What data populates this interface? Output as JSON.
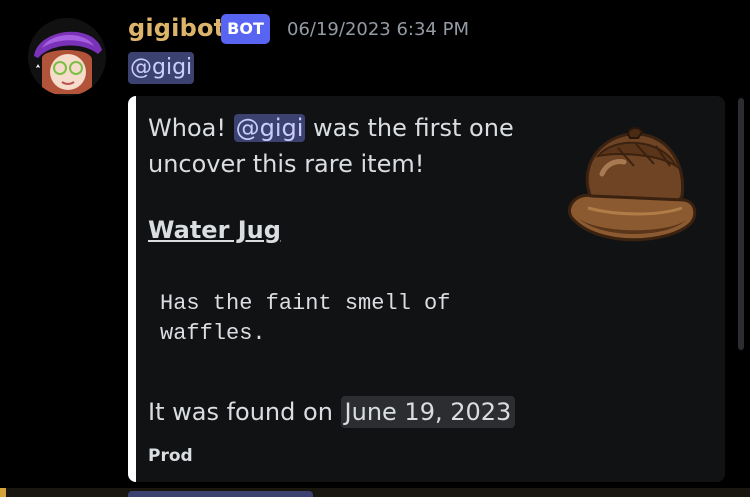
{
  "message": {
    "author": "gigibot",
    "bot_tag": "BOT",
    "timestamp": "06/19/2023 6:34 PM",
    "mention": "@gigi"
  },
  "embed": {
    "desc_before": "Whoa! ",
    "desc_mention": "@gigi",
    "desc_after": " was the first one uncover this rare item!",
    "item_name": "Water Jug",
    "item_quote": "Has the faint smell of\nwaffles.",
    "found_prefix": "It was found on ",
    "found_date": "June 19, 2023",
    "footer": "Prod",
    "thumbnail": "water-jug-acorn",
    "accent_color": "#ffffff"
  },
  "colors": {
    "background": "#000000",
    "username": "#dcb56a",
    "bot_tag": "#5865f2",
    "mention_bg": "#3c4270",
    "embed_bg": "#111214"
  }
}
